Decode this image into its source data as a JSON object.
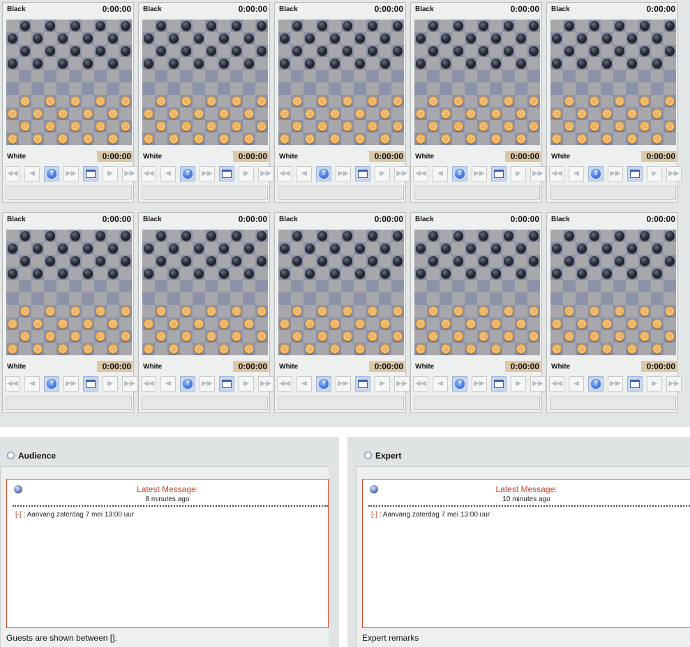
{
  "board_labels": {
    "top_player": "Black",
    "bottom_player": "White"
  },
  "clock_value": "0:00:00",
  "help_glyph": "?",
  "control_icons": [
    "first-move-icon",
    "previous-move-icon",
    "help-icon",
    "flip-board-icon",
    "window-icon",
    "next-move-icon",
    "last-move-icon"
  ],
  "colors": {
    "light_square": "#a8a8ac",
    "dark_square": "#8c93a8",
    "accent_red": "#c8452b",
    "clock_highlight": "#dcc7a7"
  },
  "boards": [
    {
      "black": "Black",
      "white": "White",
      "black_clock": "0:00:00",
      "white_clock": "0:00:00"
    },
    {
      "black": "Black",
      "white": "White",
      "black_clock": "0:00:00",
      "white_clock": "0:00:00"
    },
    {
      "black": "Black",
      "white": "White",
      "black_clock": "0:00:00",
      "white_clock": "0:00:00"
    },
    {
      "black": "Black",
      "white": "White",
      "black_clock": "0:00:00",
      "white_clock": "0:00:00"
    },
    {
      "black": "Black",
      "white": "White",
      "black_clock": "0:00:00",
      "white_clock": "0:00:00"
    },
    {
      "black": "Black",
      "white": "White",
      "black_clock": "0:00:00",
      "white_clock": "0:00:00"
    },
    {
      "black": "Black",
      "white": "White",
      "black_clock": "0:00:00",
      "white_clock": "0:00:00"
    },
    {
      "black": "Black",
      "white": "White",
      "black_clock": "0:00:00",
      "white_clock": "0:00:00"
    },
    {
      "black": "Black",
      "white": "White",
      "black_clock": "0:00:00",
      "white_clock": "0:00:00"
    },
    {
      "black": "Black",
      "white": "White",
      "black_clock": "0:00:00",
      "white_clock": "0:00:00"
    }
  ],
  "audience": {
    "title": "Audience",
    "latest_label": "Latest Message:",
    "latest_time": "8 minutes ago",
    "messages": [
      {
        "author": "[-]",
        "separator": " : ",
        "text": "Aanvang zaterdag 7 mei 13:00 uur"
      }
    ],
    "footer": "Guests are shown between []."
  },
  "expert": {
    "title": "Expert",
    "latest_label": "Latest Message:",
    "latest_time": "10 minutes ago",
    "messages": [
      {
        "author": "[-]",
        "separator": " : ",
        "text": "Aanvang zaterdag 7 mei 13:00 uur"
      }
    ],
    "footer": "Expert remarks"
  }
}
